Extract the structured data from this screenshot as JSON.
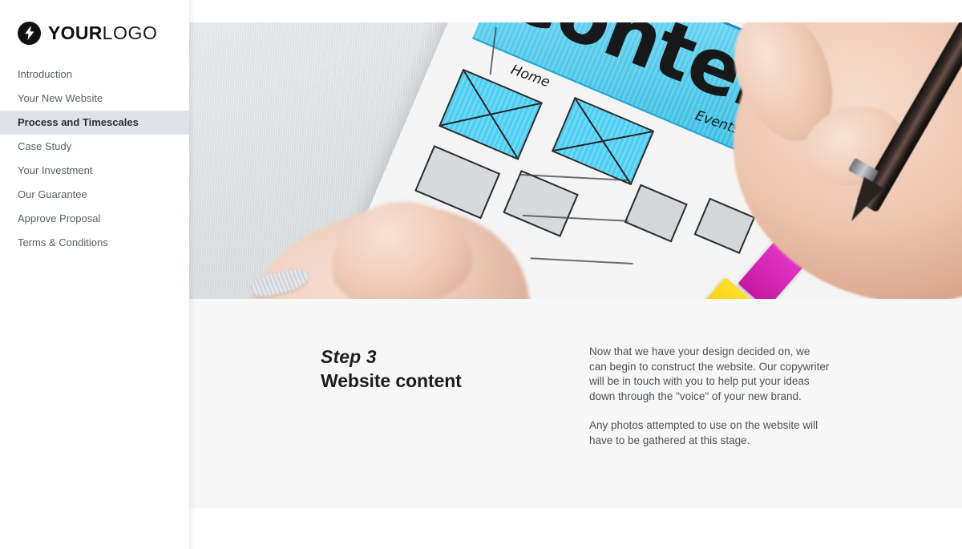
{
  "brand": {
    "icon": "lightning-bolt-icon",
    "name_bold": "YOUR",
    "name_light": "LOGO"
  },
  "sidebar": {
    "items": [
      {
        "label": "Introduction",
        "active": false
      },
      {
        "label": "Your New Website",
        "active": false
      },
      {
        "label": "Process and Timescales",
        "active": true
      },
      {
        "label": "Case Study",
        "active": false
      },
      {
        "label": "Your Investment",
        "active": false
      },
      {
        "label": "Our Guarantee",
        "active": false
      },
      {
        "label": "Approve Proposal",
        "active": false
      },
      {
        "label": "Terms & Conditions",
        "active": false
      }
    ]
  },
  "hero": {
    "alt": "Hand holding a pen sketching a website wireframe on paper with a blue highlighted Content banner",
    "sketch_word": "Content",
    "sketch_labels": {
      "home": "Home",
      "events": "Events"
    }
  },
  "main": {
    "step_label": "Step 3",
    "step_title": "Website content",
    "paragraphs": [
      "Now that we have your design decided on, we can begin to construct the website. Our copywriter will be in touch with you to help put your ideas down through the \"voice\" of your new brand.",
      "Any photos attempted to use on the website will have to be gathered at this stage."
    ]
  },
  "colors": {
    "sidebar_bg": "#ffffff",
    "sidebar_active_bg": "#dfe3e9",
    "content_bg": "#f7f7f7",
    "page_bg": "#ffffff",
    "text_primary": "#1c1d1f",
    "text_muted": "#4e5256",
    "nav_text": "#5a5f66",
    "highlight_blue": "#3fc9f0",
    "marker_magenta": "#e535c8",
    "marker_yellow": "#ffe02a"
  }
}
